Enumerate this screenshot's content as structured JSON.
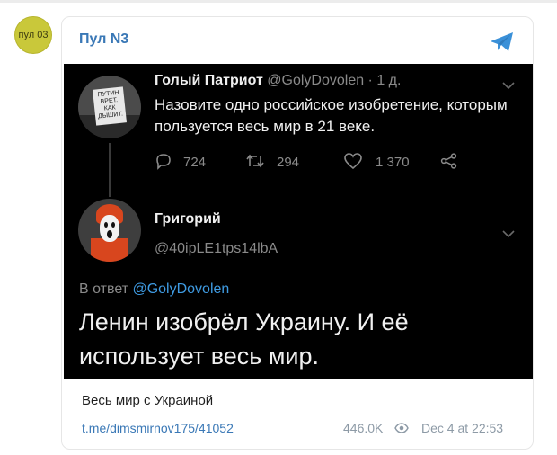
{
  "channel": {
    "avatar_text": "пул 03",
    "name": "Пул N3",
    "colors": {
      "accent": "#3a78b6",
      "avatar_bg": "#c9c83a"
    }
  },
  "tweet1": {
    "avatar_sign_text": "ПУТИН ВРЕТ. КАК ДЫШИТ.",
    "author": "Голый Патриот",
    "handle_time": "@GolyDovolen · 1 д.",
    "text": "Назовите одно российское изобретение, которым пользуется весь мир в 21 веке.",
    "replies": "724",
    "retweets": "294",
    "likes": "1 370"
  },
  "tweet2": {
    "author": "Григорий",
    "handle": "@40ipLE1tps14lbA",
    "reply_prefix": "В ответ ",
    "reply_handle": "@GolyDovolen",
    "text": "Ленин изобрёл Украину. И её использует весь мир."
  },
  "post": {
    "caption": "Весь мир с Украиной",
    "link": "t.me/dimsmirnov175/41052",
    "views": "446.0K",
    "date": "Dec 4 at 22:53"
  }
}
